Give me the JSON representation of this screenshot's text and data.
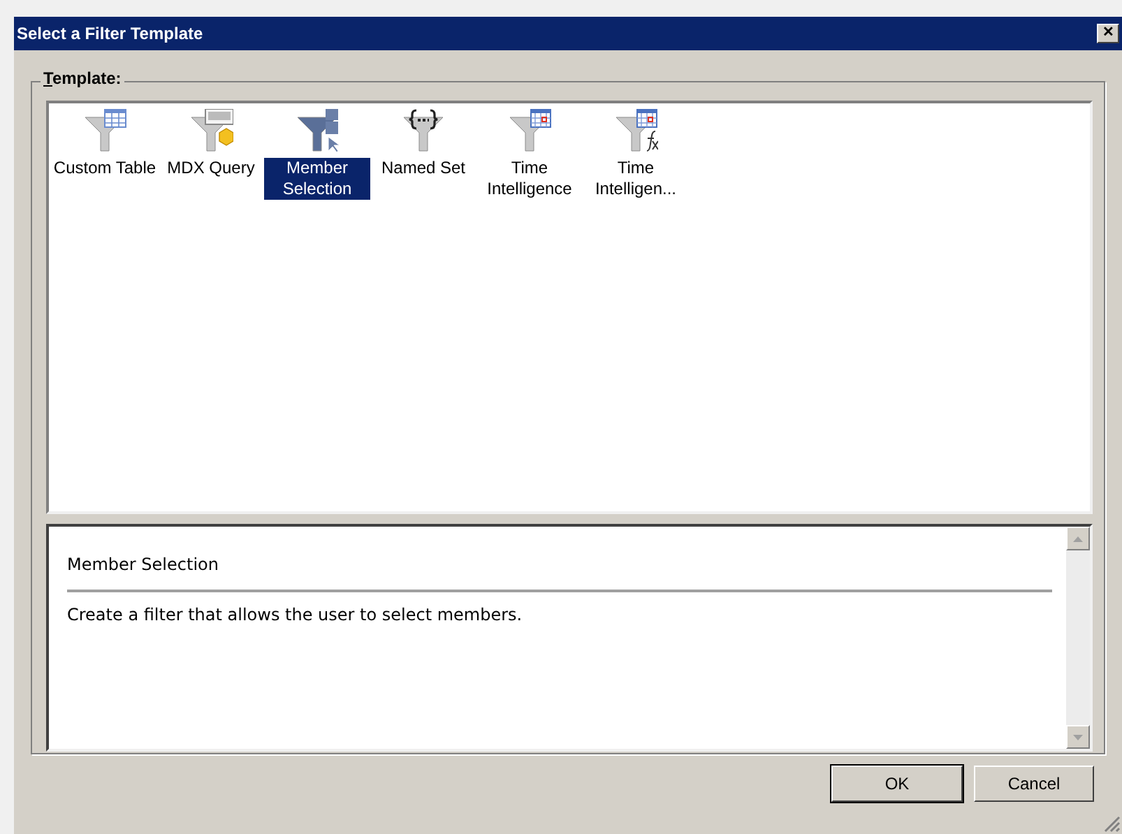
{
  "window": {
    "title": "Select a Filter Template",
    "close": "✕"
  },
  "template_group": {
    "label": "Template:"
  },
  "templates": [
    {
      "label": "Custom Table",
      "kind": "table",
      "selected": false
    },
    {
      "label": "MDX Query",
      "kind": "mdx",
      "selected": false
    },
    {
      "label": "Member Selection",
      "kind": "member",
      "selected": true
    },
    {
      "label": "Named Set",
      "kind": "namedset",
      "selected": false
    },
    {
      "label": "Time Intelligence",
      "kind": "time",
      "selected": false
    },
    {
      "label": "Time Intelligen...",
      "kind": "timefx",
      "selected": false
    }
  ],
  "description": {
    "title": "Member Selection",
    "text": "Create a filter that allows the user to select members."
  },
  "buttons": [
    {
      "label": "OK",
      "kind": "default"
    },
    {
      "label": "Cancel",
      "kind": "normal"
    }
  ]
}
